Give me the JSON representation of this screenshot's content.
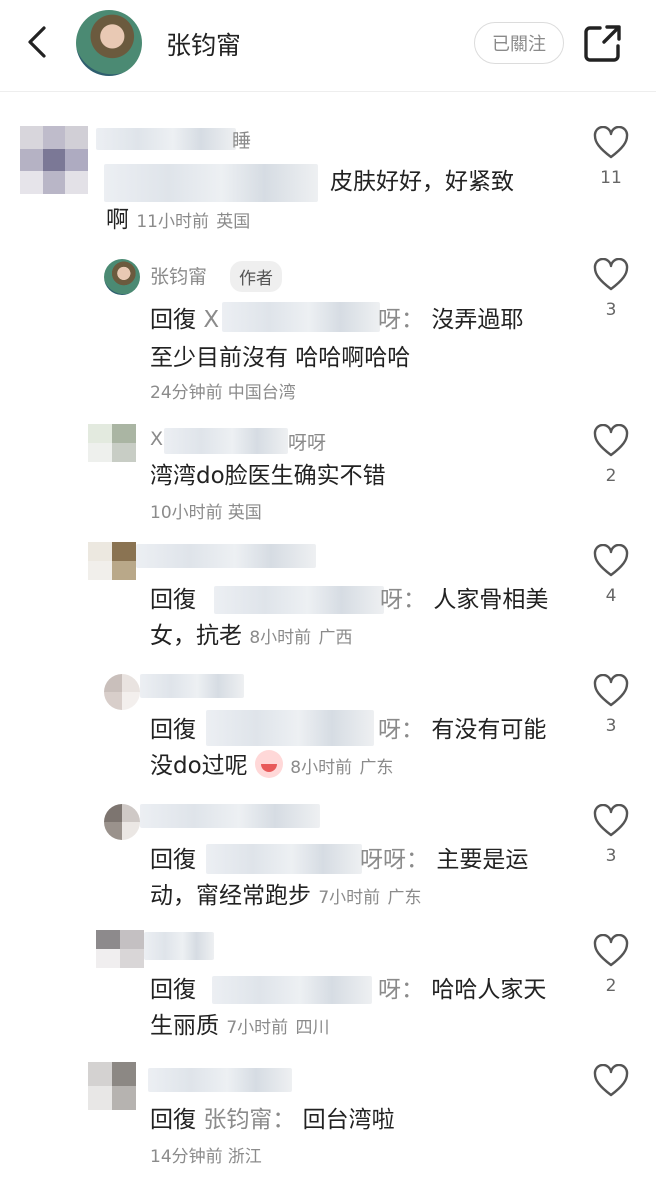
{
  "header": {
    "title": "张钧甯",
    "follow_label": "已關注"
  },
  "comments": [
    {
      "username_fragment": "睡",
      "text": "皮肤好好，好紧致",
      "text_cont": "啊",
      "time": "11小时前",
      "location": "英国",
      "likes": "11"
    },
    {
      "username": "张钧甯",
      "author_badge": "作者",
      "reply_prefix": "回復",
      "reply_to_head": "X",
      "reply_to_tail": "呀：",
      "text": "沒弄過耶",
      "text_cont": "至少目前沒有 哈哈啊哈哈",
      "time": "24分钟前",
      "location": "中国台湾",
      "likes": "3"
    },
    {
      "username_head": "X",
      "username_tail": "呀呀",
      "text": "湾湾do脸医生确实不错",
      "time": "10小时前",
      "location": "英国",
      "likes": "2"
    },
    {
      "reply_prefix": "回復",
      "reply_to_tail": "呀：",
      "text": "人家骨相美",
      "text_cont": "女，抗老",
      "time": "8小时前",
      "location": "广西",
      "likes": "4"
    },
    {
      "reply_prefix": "回復",
      "reply_to_tail": "呀：",
      "text": "有没有可能",
      "text_cont": "没do过呢",
      "time": "8小时前",
      "location": "广东",
      "likes": "3"
    },
    {
      "reply_prefix": "回復",
      "reply_to_tail": "呀呀：",
      "text": "主要是运",
      "text_cont": "动，甯经常跑步",
      "time": "7小时前",
      "location": "广东",
      "likes": "3"
    },
    {
      "reply_prefix": "回復",
      "reply_to_tail": "呀：",
      "text": "哈哈人家天",
      "text_cont": "生丽质",
      "time": "7小时前",
      "location": "四川",
      "likes": "2"
    },
    {
      "reply_prefix": "回復",
      "reply_to": "张钧甯：",
      "text": "回台湾啦",
      "time": "14分钟前",
      "location": "浙江",
      "likes": ""
    }
  ]
}
